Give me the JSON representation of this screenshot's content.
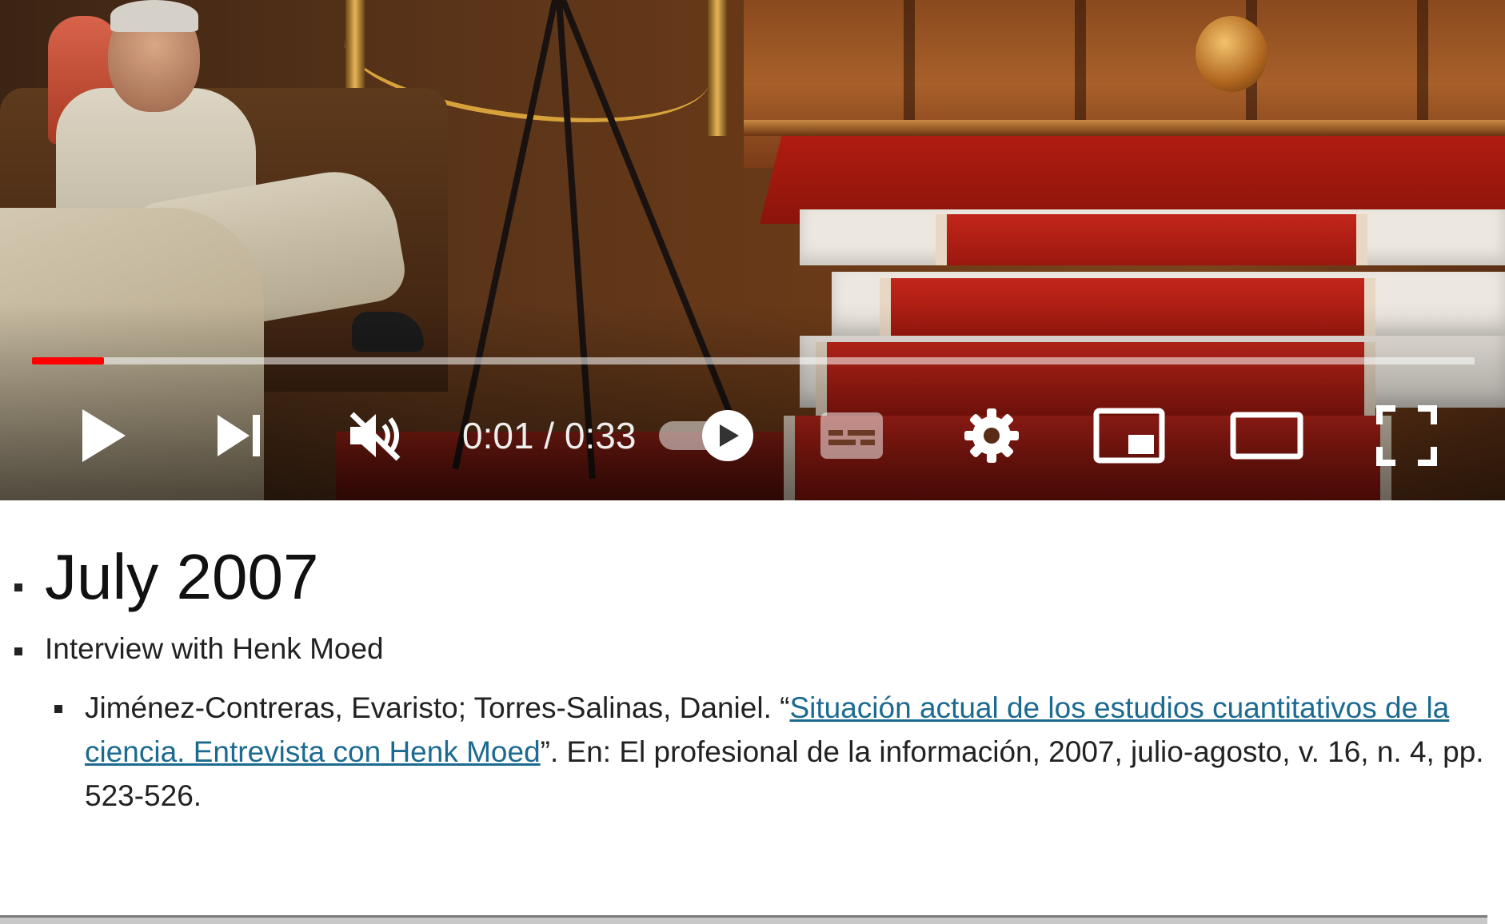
{
  "player": {
    "time_display": "0:01 / 0:33",
    "progress_fraction": 0.05,
    "muted": true,
    "autoplay_on": false,
    "colors": {
      "progress": "#ff0000",
      "track": "#ffffff",
      "icons": "#ffffff"
    },
    "icons": {
      "play": "play-icon",
      "next": "skip-next-icon",
      "mute": "volume-muted-icon",
      "autoplay": "autoplay-toggle-icon",
      "captions": "closed-captions-icon",
      "settings": "gear-icon",
      "miniplayer": "miniplayer-icon",
      "theater": "theater-mode-icon",
      "fullscreen": "fullscreen-icon"
    }
  },
  "article": {
    "heading": "July 2007",
    "subheading": "Interview with Henk Moed",
    "citation": {
      "authors": "Jiménez-Contreras, Evaristo; Torres-Salinas, Daniel. “",
      "link_text": "Situación actual de los estudios cuantitativos de la ciencia. Entrevista con Henk Moed",
      "suffix": "”. En: El profesional de la información, 2007, julio-agosto, v. 16, n. 4, pp. 523-526."
    },
    "link_color": "#1c6a8f"
  }
}
